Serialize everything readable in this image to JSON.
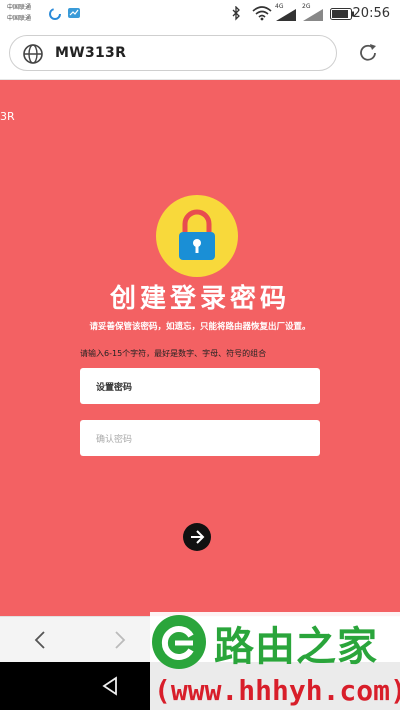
{
  "status_bar": {
    "carrier_line1": "中国联通",
    "carrier_line2": "中国联通",
    "network_1": "4G",
    "network_2": "2G",
    "time": "20:56"
  },
  "address_bar": {
    "url": "MW313R"
  },
  "page": {
    "title_fragment": "3R",
    "title": "创建登录密码",
    "subtitle": "请妥善保管该密码，如遗忘，只能将路由器恢复出厂设置。",
    "hint": "请输入6-15个字符，最好是数字、字母、符号的组合",
    "password_placeholder": "设置密码",
    "confirm_placeholder": "确认密码"
  },
  "watermark": {
    "brand": "路由之家",
    "url": "(www.hhhyh.com)"
  },
  "colors": {
    "page_background": "#f36163",
    "lock_circle": "#f8d93b",
    "lock_body": "#1a8fd6",
    "watermark_green": "#2aa53b",
    "watermark_red": "#d81e2a"
  },
  "icons": {
    "address_bar": "globe-icon",
    "reload": "reload-icon",
    "lock": "padlock-icon",
    "next": "arrow-right-icon",
    "back": "chevron-left-icon",
    "forward": "chevron-right-icon",
    "sys_back": "triangle-back-icon"
  }
}
